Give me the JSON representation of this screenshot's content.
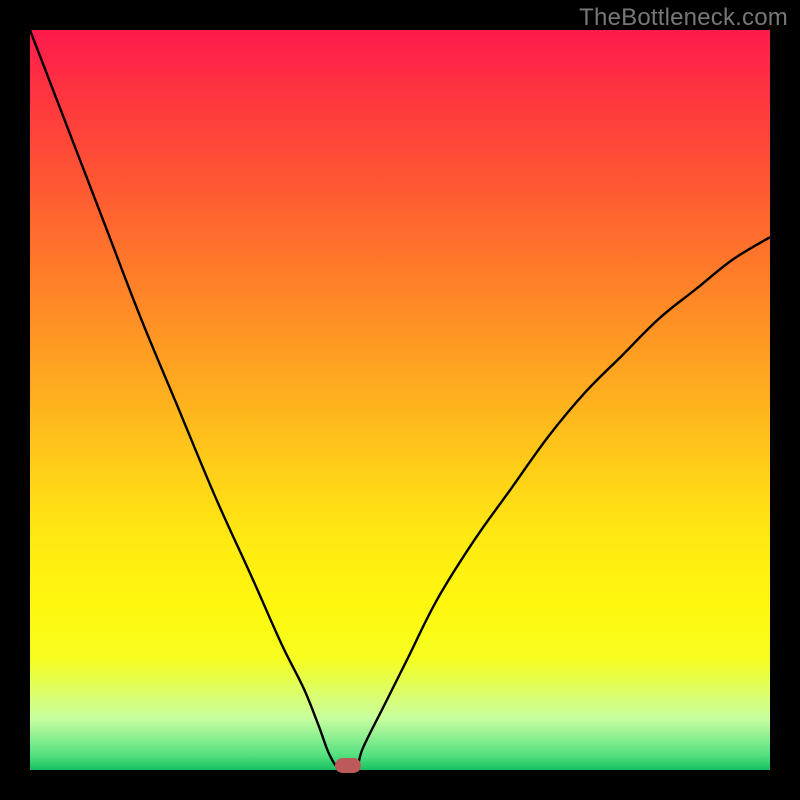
{
  "watermark": "TheBottleneck.com",
  "colors": {
    "frame": "#000000",
    "gradient_top": "#ff1a4d",
    "gradient_bottom": "#18c060",
    "curve": "#000000",
    "marker": "#bb5a58"
  },
  "chart_data": {
    "type": "line",
    "title": "",
    "xlabel": "",
    "ylabel": "",
    "xlim": [
      0,
      100
    ],
    "ylim": [
      0,
      100
    ],
    "grid": false,
    "legend": false,
    "series": [
      {
        "name": "bottleneck-curve",
        "x": [
          0,
          5,
          10,
          15,
          20,
          25,
          30,
          34,
          37,
          39,
          40.5,
          42,
          44,
          45,
          48,
          51,
          55,
          60,
          65,
          70,
          75,
          80,
          85,
          90,
          95,
          100
        ],
        "values": [
          100,
          87,
          74,
          61,
          49,
          37,
          26,
          17,
          11,
          6,
          2,
          0,
          0,
          3,
          9,
          15,
          23,
          31,
          38,
          45,
          51,
          56,
          61,
          65,
          69,
          72
        ]
      }
    ],
    "marker": {
      "x": 43,
      "y": 0
    },
    "annotations": []
  }
}
